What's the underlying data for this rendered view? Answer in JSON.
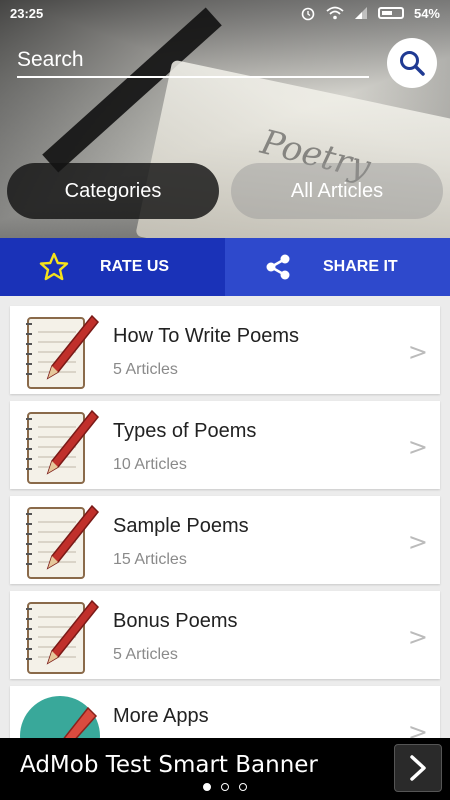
{
  "status_bar": {
    "time": "23:25",
    "battery": "54%",
    "icons": [
      "alarm-icon",
      "wifi-icon",
      "signal-icon",
      "battery-icon"
    ]
  },
  "search": {
    "placeholder": "Search",
    "icon": "search-icon"
  },
  "tabs": [
    {
      "label": "Categories",
      "active": true
    },
    {
      "label": "All Articles",
      "active": false
    }
  ],
  "actions": {
    "rate": {
      "label": "RATE US",
      "icon": "star-icon"
    },
    "share": {
      "label": "SHARE IT",
      "icon": "share-icon"
    }
  },
  "categories": [
    {
      "title": "How To Write Poems",
      "count": "5 Articles",
      "icon": "notepad-pencil-icon"
    },
    {
      "title": "Types of Poems",
      "count": "10 Articles",
      "icon": "notepad-pencil-icon"
    },
    {
      "title": "Sample Poems",
      "count": "15 Articles",
      "icon": "notepad-pencil-icon"
    },
    {
      "title": "Bonus Poems",
      "count": "5 Articles",
      "icon": "notepad-pencil-icon"
    },
    {
      "title": "More Apps",
      "count": "",
      "icon": "apps-pencil-icon"
    }
  ],
  "chevron": ">",
  "ad": {
    "text": "AdMob Test Smart Banner"
  },
  "colors": {
    "rate_bg": "#1a32b8",
    "share_bg": "#2e49cc",
    "star": "#f5e21b"
  }
}
